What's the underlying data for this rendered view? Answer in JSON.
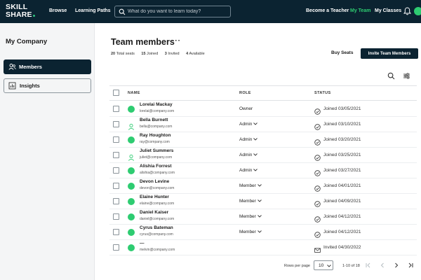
{
  "app": {
    "logo_line1": "SKILL",
    "logo_line2": "SHARE"
  },
  "topnav": {
    "browse": "Browse",
    "learning_paths": "Learning Paths",
    "search_placeholder": "What do you want to learn today?",
    "become_teacher": "Become a Teacher",
    "my_team": "My Team",
    "my_classes": "My Classes",
    "accent_color": "#2ecc71"
  },
  "sidebar": {
    "company": "My Company",
    "items": [
      {
        "label": "Members",
        "icon": "members-icon",
        "active": true
      },
      {
        "label": "Insights",
        "icon": "insights-icon",
        "active": false
      }
    ]
  },
  "main": {
    "title": "Team members",
    "more": "···",
    "stats": [
      {
        "count": "20",
        "label": "Total seats"
      },
      {
        "count": "15",
        "label": "Joined"
      },
      {
        "count": "3",
        "label": "Invited"
      },
      {
        "count": "4",
        "label": "Available"
      }
    ],
    "buy_seats": "Buy Seats",
    "invite": "Invite Team Members"
  },
  "table": {
    "columns": {
      "name": "NAME",
      "role": "ROLE",
      "status": "STATUS"
    },
    "rows": [
      {
        "name": "Lorelai Mackay",
        "email": "lorelai@company.com",
        "role": "Owner",
        "dropdown": false,
        "status": "Joined 03/05/2021",
        "avatar": "green",
        "status_icon": "check-circle-icon"
      },
      {
        "name": "Bella Burnett",
        "email": "bella@company.com",
        "role": "Admin",
        "dropdown": true,
        "status": "Joined 03/10/2021",
        "avatar": "outline",
        "status_icon": "check-circle-icon"
      },
      {
        "name": "Ray Houghton",
        "email": "ray@company.com",
        "role": "Admin",
        "dropdown": true,
        "status": "Joined 03/20/2021",
        "avatar": "green",
        "status_icon": "check-circle-icon"
      },
      {
        "name": "Juliet Summers",
        "email": "juliet@company.com",
        "role": "Admin",
        "dropdown": true,
        "status": "Joined 03/25/2021",
        "avatar": "outline",
        "status_icon": "check-circle-icon"
      },
      {
        "name": "Alishia Forrest",
        "email": "alishia@company.com",
        "role": "Admin",
        "dropdown": true,
        "status": "Joined 03/27/2021",
        "avatar": "green",
        "status_icon": "check-circle-icon"
      },
      {
        "name": "Devon Levine",
        "email": "devon@company.com",
        "role": "Member",
        "dropdown": true,
        "status": "Joined 04/01/2021",
        "avatar": "green",
        "status_icon": "check-circle-icon"
      },
      {
        "name": "Elaine Hunter",
        "email": "elaine@company.com",
        "role": "Member",
        "dropdown": true,
        "status": "Joined 04/09/2021",
        "avatar": "green",
        "status_icon": "check-circle-icon"
      },
      {
        "name": "Daniel Kaiser",
        "email": "daniel@company.com",
        "role": "Member",
        "dropdown": true,
        "status": "Joined 04/12/2021",
        "avatar": "green",
        "status_icon": "check-circle-icon"
      },
      {
        "name": "Cyrus Bateman",
        "email": "cyrus@company.com",
        "role": "Member",
        "dropdown": true,
        "status": "Joined 04/12/2021",
        "avatar": "green",
        "status_icon": "check-circle-icon"
      },
      {
        "name": "—",
        "email": "melvin@company.com",
        "role": "",
        "dropdown": false,
        "status": "Invited 04/30/2022",
        "avatar": "green",
        "status_icon": "mail-icon"
      }
    ]
  },
  "pagination": {
    "rows_per_page_label": "Rows per page",
    "rows_per_page": "10",
    "range": "1-10 of 18"
  }
}
